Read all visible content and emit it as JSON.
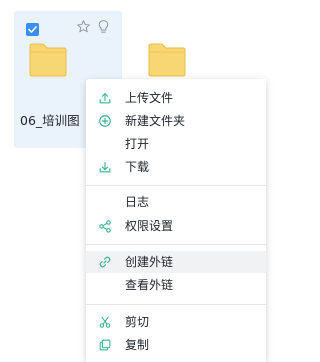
{
  "file": {
    "name": "06_培训图",
    "selected": true
  },
  "context_menu": {
    "items": [
      {
        "label": "上传文件",
        "icon": "upload-icon"
      },
      {
        "label": "新建文件夹",
        "icon": "add-circle-icon"
      },
      {
        "label": "打开",
        "icon": ""
      },
      {
        "label": "下载",
        "icon": "download-icon"
      },
      {
        "label": "日志",
        "icon": ""
      },
      {
        "label": "权限设置",
        "icon": "share-nodes-icon"
      },
      {
        "label": "创建外链",
        "icon": "link-icon"
      },
      {
        "label": "查看外链",
        "icon": ""
      },
      {
        "label": "剪切",
        "icon": "scissors-icon"
      },
      {
        "label": "复制",
        "icon": "copy-icon"
      }
    ]
  },
  "colors": {
    "accent": "#3a8ef0",
    "icon_green": "#3db38a",
    "folder": "#f7d774",
    "selection_bg": "#eaf3fc",
    "hover_bg": "#f1f2f4"
  }
}
